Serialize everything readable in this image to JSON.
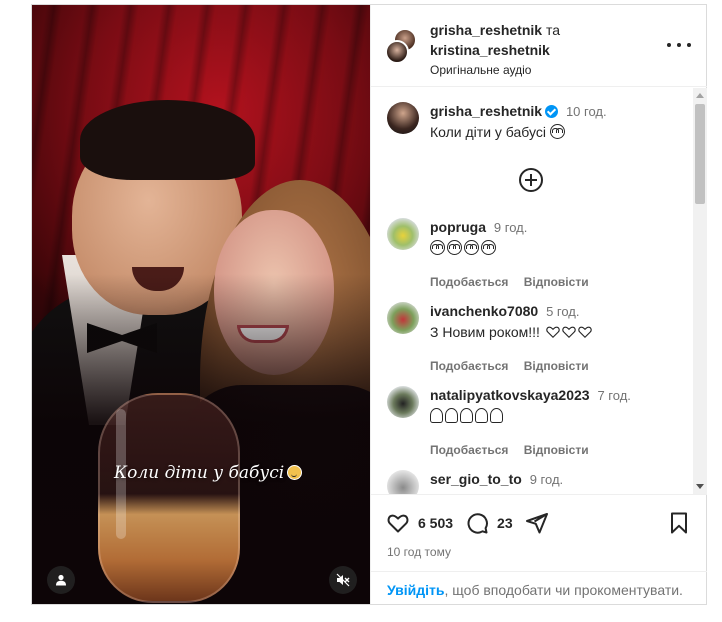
{
  "header": {
    "user1": "grisha_reshetnik",
    "connector": "та",
    "user2": "kristina_reshetnik",
    "audio": "Оригінальне аудіо"
  },
  "media": {
    "caption_overlay": "Коли діти у бабусі"
  },
  "caption": {
    "user": "grisha_reshetnik",
    "time": "10 год.",
    "text": "Коли діти у бабусі"
  },
  "comments": [
    {
      "user": "popruga",
      "time": "9 год.",
      "text": "",
      "emoji": [
        "smiling-face-with-heart-eyes",
        "smiling-face-with-heart-eyes",
        "smiling-face-with-heart-eyes",
        "smiling-face-with-heart-eyes"
      ]
    },
    {
      "user": "ivanchenko7080",
      "time": "5 год.",
      "text": "З Новим роком!!!",
      "emoji": [
        "white-heart",
        "white-heart",
        "white-heart"
      ]
    },
    {
      "user": "natalipyatkovskaya2023",
      "time": "7 год.",
      "text": "",
      "emoji": [
        "folded-hands",
        "folded-hands",
        "folded-hands",
        "folded-hands",
        "folded-hands"
      ]
    },
    {
      "user": "ser_gio_to_to",
      "time": "9 год.",
      "text": "",
      "emoji": []
    }
  ],
  "actions": {
    "like": "Подобається",
    "reply": "Відповісти"
  },
  "footer": {
    "likes": "6 503",
    "comments": "23",
    "timestamp": "10 год тому",
    "login_link": "Увійдіть",
    "login_text": ", щоб вподобати чи прокоментувати."
  },
  "colors": {
    "accent": "#0095f6",
    "text": "#262626",
    "secondary": "#737373"
  }
}
